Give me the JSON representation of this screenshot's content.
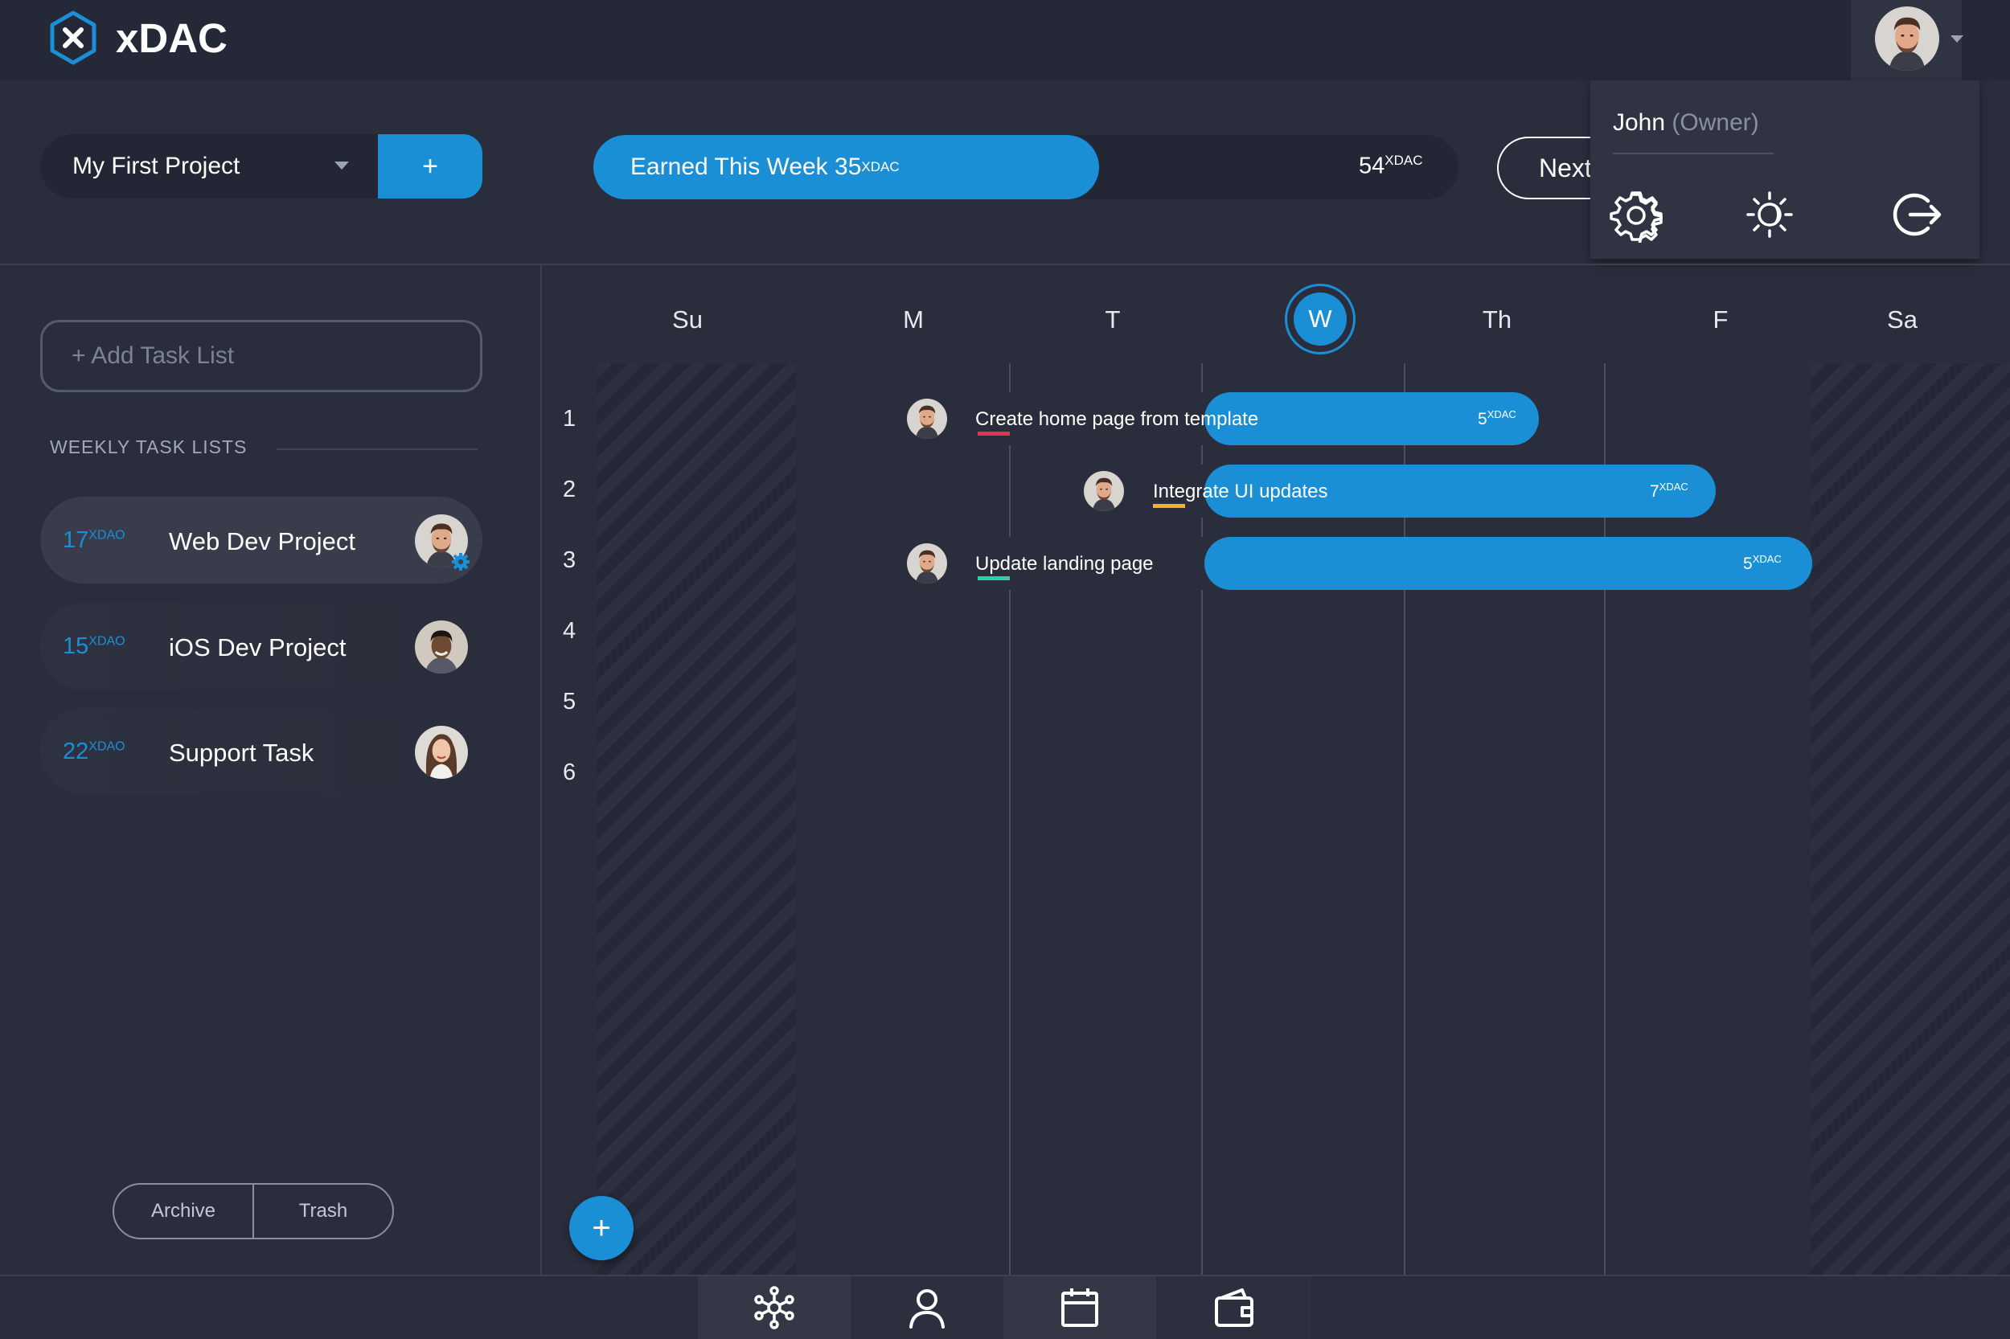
{
  "app": {
    "name": "xDAC"
  },
  "project": {
    "selected": "My First Project",
    "add_label": "+"
  },
  "earnings": {
    "label": "Earned This Week 35",
    "unit": "XDAC",
    "goal": "54",
    "goal_unit": "XDAC",
    "progress": 0.65
  },
  "nav": {
    "next_label": "Next"
  },
  "user": {
    "name": "John",
    "role": "(Owner)"
  },
  "sidebar": {
    "add_list_label": "+ Add Task List",
    "section_label": "WEEKLY TASK LISTS",
    "lists": [
      {
        "amount": "17",
        "unit": "XDAO",
        "name": "Web Dev Project"
      },
      {
        "amount": "15",
        "unit": "XDAO",
        "name": "iOS Dev Project"
      },
      {
        "amount": "22",
        "unit": "XDAO",
        "name": "Support Task"
      }
    ],
    "archive_label": "Archive",
    "trash_label": "Trash"
  },
  "calendar": {
    "days": [
      "Su",
      "M",
      "T",
      "W",
      "Th",
      "F",
      "Sa"
    ],
    "today": "W",
    "rows": [
      "1",
      "2",
      "3",
      "4",
      "5",
      "6"
    ],
    "tasks": [
      {
        "title": "Create home page from template",
        "value": "5",
        "unit": "XDAC",
        "tag_color": "#e0344a"
      },
      {
        "title": "Integrate UI updates",
        "value": "7",
        "unit": "XDAC",
        "tag_color": "#f0b323"
      },
      {
        "title": "Update landing page",
        "value": "5",
        "unit": "XDAC",
        "tag_color": "#27d3a2"
      }
    ]
  },
  "fab_label": "+",
  "colors": {
    "accent": "#1b8fd6",
    "background": "#2a2e3c",
    "topbar": "#252937"
  },
  "bottom_nav": [
    {
      "icon": "network-icon"
    },
    {
      "icon": "user-icon"
    },
    {
      "icon": "calendar-icon"
    },
    {
      "icon": "wallet-icon"
    }
  ]
}
